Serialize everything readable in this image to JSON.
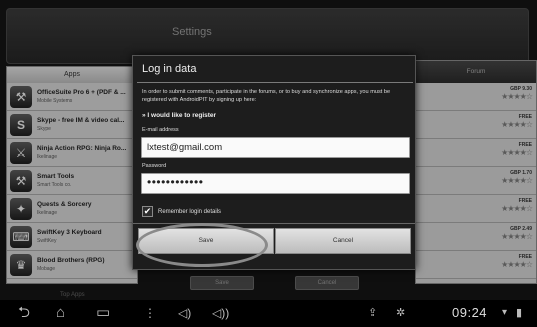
{
  "screen": {
    "title": "Settings"
  },
  "apps_panel": {
    "header": "Apps",
    "items": [
      {
        "icon": "⚒",
        "name": "OfficeSuite Pro 6 + (PDF & ...",
        "developer": "Mobile Systems"
      },
      {
        "icon": "S",
        "name": "Skype - free IM & video cal...",
        "developer": "Skype"
      },
      {
        "icon": "⚔",
        "name": "Ninja Action RPG: Ninja Ro...",
        "developer": "Ikelinage"
      },
      {
        "icon": "⚒",
        "name": "Smart Tools",
        "developer": "Smart Tools co."
      },
      {
        "icon": "✦",
        "name": "Quests & Sorcery",
        "developer": "Ikelinage"
      },
      {
        "icon": "⌨",
        "name": "SwiftKey 3 Keyboard",
        "developer": "SwiftKey"
      },
      {
        "icon": "♛",
        "name": "Blood Brothers (RPG)",
        "developer": "Mobage"
      }
    ]
  },
  "forum_panel": {
    "header": "Forum",
    "rows": [
      {
        "price": "GBP 9.30",
        "stars": "★★★★☆"
      },
      {
        "price": "FREE",
        "stars": "★★★★☆"
      },
      {
        "price": "FREE",
        "stars": "★★★★☆"
      },
      {
        "price": "GBP 1.70",
        "stars": "★★★★☆"
      },
      {
        "price": "FREE",
        "stars": "★★★★☆"
      },
      {
        "price": "GBP 2.49",
        "stars": "★★★★☆"
      },
      {
        "price": "FREE",
        "stars": "★★★★☆"
      }
    ]
  },
  "background": {
    "save_label": "Save",
    "cancel_label": "Cancel",
    "bottom_link": "Top Apps"
  },
  "dialog": {
    "title": "Log in data",
    "info": "In order to submit comments, participate in the forums, or to buy and synchronize apps, you must be registered with AndroidPIT by signing up here:",
    "register_link": "» I would like to register",
    "email_label": "E-mail address",
    "email_value": "lxtest@gmail.com",
    "password_label": "Password",
    "password_value": "••••••••••••",
    "remember_checked": true,
    "remember_label": "Remember login details",
    "save_label": "Save",
    "cancel_label": "Cancel"
  },
  "system_bar": {
    "clock": "09:24",
    "icons": [
      "back-icon",
      "home-icon",
      "recent-apps-icon",
      "menu-icon",
      "volume-down-icon",
      "volume-up-icon",
      "usb-icon",
      "android-debug-icon",
      "wifi-icon",
      "battery-icon"
    ]
  },
  "colors": {
    "dialog_bg": "#1d1d1d",
    "field_bg": "#fafafa",
    "button_bg": "#d0d0d0",
    "system_bar": "#000000"
  }
}
